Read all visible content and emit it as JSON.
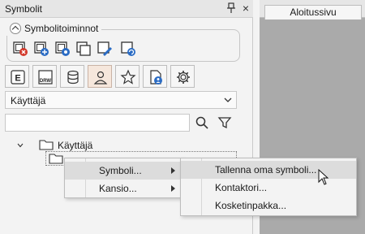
{
  "panel": {
    "title": "Symbolit",
    "group_caption": "Symbolitoiminnot",
    "toolbar_icons": [
      "delete-symbol-icon",
      "add-symbol-icon",
      "add-symbol-alt-icon",
      "copy-symbol-icon",
      "edit-symbol-icon",
      "refresh-symbol-icon"
    ],
    "tabs": [
      "E",
      "DRW",
      "database-icon",
      "user-icon",
      "star-icon",
      "document-user-icon",
      "gear-icon"
    ],
    "dropdown_value": "Käyttäjä",
    "search_placeholder": "",
    "tree": {
      "root_label": "Käyttäjä"
    }
  },
  "document_area": {
    "tab_label": "Aloitussivu"
  },
  "context_menu": {
    "items": [
      {
        "label": "Symboli..."
      },
      {
        "label": "Kansio..."
      }
    ]
  },
  "submenu": {
    "items": [
      {
        "label": "Tallenna oma symboli..."
      },
      {
        "label": "Kontaktori..."
      },
      {
        "label": "Kosketinpakka..."
      }
    ]
  },
  "colors": {
    "accent_blue": "#2b6cc4",
    "delete_red": "#d33a2c",
    "active_tab": "#f6e7dc"
  }
}
